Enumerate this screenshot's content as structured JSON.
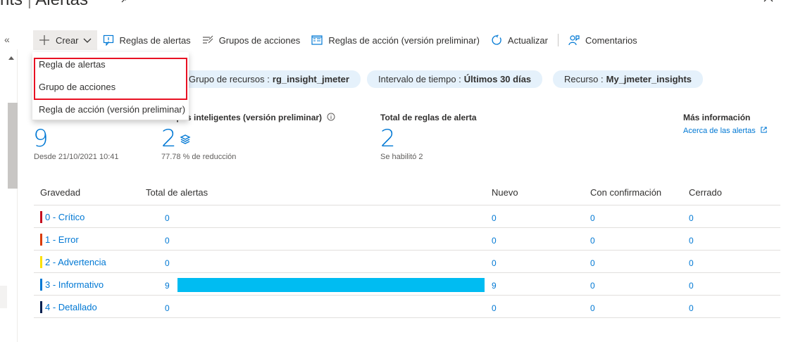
{
  "header": {
    "title_prefix": "nts",
    "title_sep": "|",
    "title": "Alertas"
  },
  "toolbar": {
    "create": "Crear",
    "alert_rules": "Reglas de alertas",
    "action_groups": "Grupos de acciones",
    "action_rules": "Reglas de acción (versión preliminar)",
    "refresh": "Actualizar",
    "feedback": "Comentarios"
  },
  "create_menu": {
    "items": [
      "Regla de alertas",
      "Grupo de acciones",
      "Regla de acción (versión preliminar)"
    ]
  },
  "filters": [
    {
      "label": "Grupo de recursos :",
      "value": "rg_insight_jmeter"
    },
    {
      "label": "Intervalo de tiempo :",
      "value": "Últimos 30 días"
    },
    {
      "label": "Recurso :",
      "value": "My_jmeter_insights"
    }
  ],
  "summary": {
    "total_alerts_value": "9",
    "total_alerts_sub": "Desde 21/10/2021 10:41",
    "smart_groups_label": "Grupos inteligentes (versión preliminar)",
    "smart_groups_value": "2",
    "smart_groups_sub": "77.78 % de reducción",
    "rules_label": "Total de reglas de alerta",
    "rules_value": "2",
    "rules_sub": "Se habilitó 2",
    "more_info_label": "Más información",
    "more_info_link": "Acerca de las alertas"
  },
  "table": {
    "headers": [
      "Gravedad",
      "Total de alertas",
      "Nuevo",
      "Con confirmación",
      "Cerrado"
    ],
    "rows": [
      {
        "severity": "0 - Crítico",
        "color": "#c50f1f",
        "total": "0",
        "total_fraction": 0,
        "new": "0",
        "ack": "0",
        "closed": "0"
      },
      {
        "severity": "1 - Error",
        "color": "#da3b01",
        "total": "0",
        "total_fraction": 0,
        "new": "0",
        "ack": "0",
        "closed": "0"
      },
      {
        "severity": "2 - Advertencia",
        "color": "#fce100",
        "total": "0",
        "total_fraction": 0,
        "new": "0",
        "ack": "0",
        "closed": "0"
      },
      {
        "severity": "3 - Informativo",
        "color": "#0078d4",
        "total": "9",
        "total_fraction": 1,
        "new": "9",
        "ack": "0",
        "closed": "0"
      },
      {
        "severity": "4 - Detallado",
        "color": "#002050",
        "total": "0",
        "total_fraction": 0,
        "new": "0",
        "ack": "0",
        "closed": "0"
      }
    ]
  }
}
